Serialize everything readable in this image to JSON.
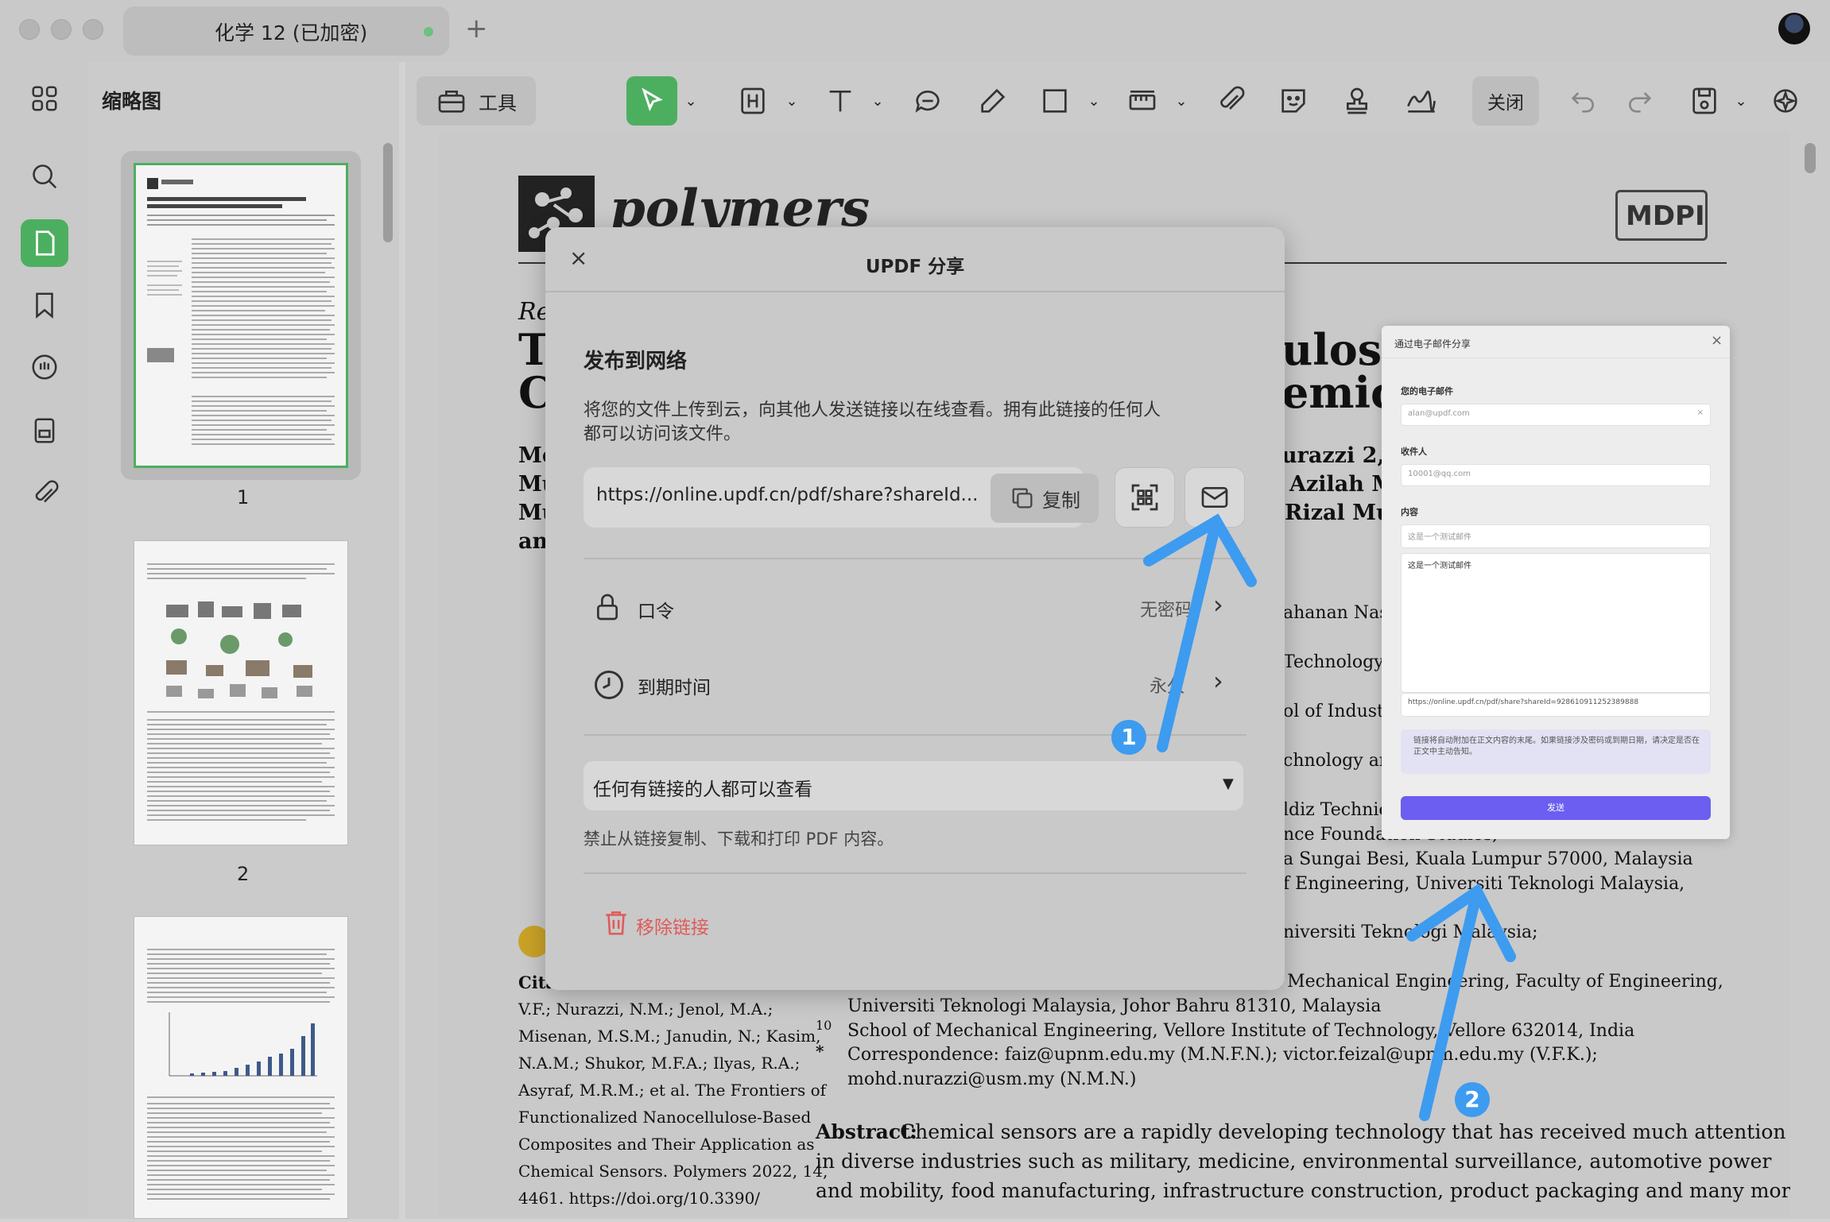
{
  "tab": {
    "title": "化学 12 (已加密)",
    "new_tab": "+"
  },
  "sidebar": {
    "title": "缩略图",
    "pages": [
      "1",
      "2"
    ]
  },
  "toolbar": {
    "tools_label": "工具",
    "close_label": "关闭"
  },
  "document": {
    "journal": "polymers",
    "publisher": "MDPI",
    "review_label": "Rev",
    "title_fragments": [
      "T",
      "C",
      "ulose",
      "emica"
    ],
    "author_fragments": [
      "Mc",
      "Mu",
      "Mu",
      "an",
      "urazzi 2,3,",
      "Azilah M",
      "Rizal Mu"
    ],
    "affiliation_fragments": [
      "ahanan Nasi",
      "Technology,",
      "ol of Industr",
      "chnology an",
      "ldiz Technica",
      "nce Foundation Studies,",
      "a Sungai Besi, Kuala Lumpur 57000, Malaysia",
      "f Engineering, Universiti Teknologi Malaysia,",
      "niversiti Teknologi Malaysia;"
    ],
    "citation_label": "Cita",
    "citation_lines": [
      "V.F.; Nurazzi, N.M.; Jenol, M.A.;",
      "Misenan, M.S.M.; Janudin, N.; Kasim,",
      "N.A.M.; Shukor, M.F.A.; Ilyas, R.A.;",
      "Asyraf, M.R.M.; et al. The Frontiers of",
      "Functionalized Nanocellulose-Based",
      "Composites and Their Application as",
      "Chemical Sensors. Polymers 2022, 14,",
      "4461.  https://doi.org/10.3390/"
    ],
    "affiliation_lines": [
      {
        "num": "",
        "text": "f Mechanical Engineering, Faculty of Engineering,"
      },
      {
        "num": "",
        "text": "Universiti Teknologi Malaysia, Johor Bahru 81310, Malaysia"
      },
      {
        "num": "10",
        "text": "School of Mechanical Engineering, Vellore Institute of Technology, Vellore 632014, India"
      },
      {
        "num": "*",
        "text": "Correspondence: faiz@upnm.edu.my (M.N.F.N.); victor.feizal@upnm.edu.my (V.F.K.);"
      },
      {
        "num": "",
        "text": "mohd.nurazzi@usm.my (N.M.N.)"
      }
    ],
    "abstract_label": "Abstract:",
    "abstract_lines": [
      " Chemical sensors are a rapidly developing technology that has received much attention",
      "in diverse industries such as military, medicine, environmental surveillance, automotive power",
      "and mobility, food manufacturing, infrastructure construction, product packaging and many more."
    ]
  },
  "share_dialog": {
    "title": "UPDF 分享",
    "close": "×",
    "heading": "发布到网络",
    "description_line1": "将您的文件上传到云，向其他人发送链接以在线查看。拥有此链接的任何人",
    "description_line2": "都可以访问该文件。",
    "url": "https://online.updf.cn/pdf/share?shareId...",
    "copy_label": "复制",
    "password_label": "口令",
    "password_value": "无密码",
    "expiry_label": "到期时间",
    "expiry_value": "永久",
    "permission": "任何有链接的人都可以查看",
    "restriction": "禁止从链接复制、下载和打印 PDF 内容。",
    "remove_link": "移除链接"
  },
  "email_panel": {
    "title": "通过电子邮件分享",
    "close": "×",
    "your_email_label": "您的电子邮件",
    "your_email_value": "alan@updf.com",
    "recipient_label": "收件人",
    "recipient_value": "10001@qq.com",
    "content_label": "内容",
    "subject_value": "这是一个测试邮件",
    "body_value": "这是一个测试邮件",
    "link_value": "https://online.updf.cn/pdf/share?shareId=928610911252389888",
    "notice": "链接将自动附加在正文内容的末尾。如果链接涉及密码或到期日期，请决定是否在正文中主动告知。",
    "send_label": "发送"
  },
  "annotations": {
    "badge1": "1",
    "badge2": "2"
  },
  "colors": {
    "accent": "#4caf60",
    "arrow": "#3d9bf0",
    "danger": "#e05a5a",
    "send": "#6b5ef0"
  }
}
